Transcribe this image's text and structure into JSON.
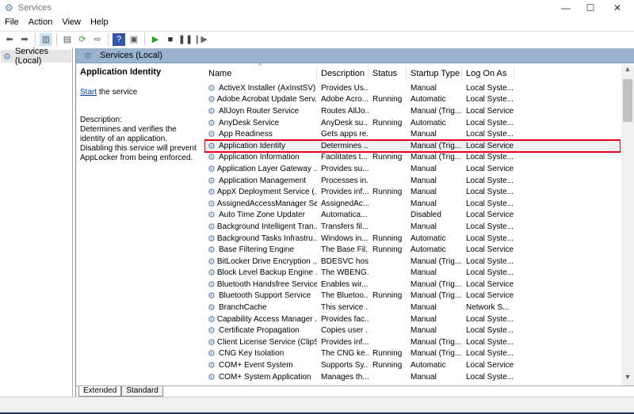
{
  "window": {
    "title": "Services",
    "minimize": "—",
    "maximize": "☐",
    "close": "✕"
  },
  "menu": [
    "File",
    "Action",
    "View",
    "Help"
  ],
  "tree": {
    "item": "Services (Local)"
  },
  "panel": {
    "title": "Services (Local)"
  },
  "detail": {
    "title": "Application Identity",
    "start_link": "Start",
    "start_rest": " the service",
    "desc_label": "Description:",
    "desc_text": "Determines and verifies the identity of an application. Disabling this service will prevent AppLocker from being enforced."
  },
  "columns": [
    "Name",
    "Description",
    "Status",
    "Startup Type",
    "Log On As"
  ],
  "rows": [
    [
      "ActiveX Installer (AxInstSV)",
      "Provides Us...",
      "",
      "Manual",
      "Local Syste..."
    ],
    [
      "Adobe Acrobat Update Serv...",
      "Adobe Acro...",
      "Running",
      "Automatic",
      "Local Syste..."
    ],
    [
      "AllJoyn Router Service",
      "Routes AllJo...",
      "",
      "Manual (Trig...",
      "Local Service"
    ],
    [
      "AnyDesk Service",
      "AnyDesk su...",
      "Running",
      "Automatic",
      "Local Syste..."
    ],
    [
      "App Readiness",
      "Gets apps re...",
      "",
      "Manual",
      "Local Syste..."
    ],
    [
      "Application Identity",
      "Determines ...",
      "",
      "Manual (Trig...",
      "Local Service"
    ],
    [
      "Application Information",
      "Facilitates t...",
      "Running",
      "Manual (Trig...",
      "Local Syste..."
    ],
    [
      "Application Layer Gateway ...",
      "Provides su...",
      "",
      "Manual",
      "Local Service"
    ],
    [
      "Application Management",
      "Processes in...",
      "",
      "Manual",
      "Local Syste..."
    ],
    [
      "AppX Deployment Service (...",
      "Provides inf...",
      "Running",
      "Manual",
      "Local Syste..."
    ],
    [
      "AssignedAccessManager Se...",
      "AssignedAc...",
      "",
      "Manual",
      "Local Syste..."
    ],
    [
      "Auto Time Zone Updater",
      "Automatica...",
      "",
      "Disabled",
      "Local Service"
    ],
    [
      "Background Intelligent Tran...",
      "Transfers fil...",
      "",
      "Manual",
      "Local Syste..."
    ],
    [
      "Background Tasks Infrastru...",
      "Windows in...",
      "Running",
      "Automatic",
      "Local Syste..."
    ],
    [
      "Base Filtering Engine",
      "The Base Fil...",
      "Running",
      "Automatic",
      "Local Service"
    ],
    [
      "BitLocker Drive Encryption ...",
      "BDESVC hos...",
      "",
      "Manual (Trig...",
      "Local Syste..."
    ],
    [
      "Block Level Backup Engine ...",
      "The WBENG...",
      "",
      "Manual",
      "Local Syste..."
    ],
    [
      "Bluetooth Handsfree Service",
      "Enables wir...",
      "",
      "Manual (Trig...",
      "Local Service"
    ],
    [
      "Bluetooth Support Service",
      "The Bluetoo...",
      "Running",
      "Manual (Trig...",
      "Local Service"
    ],
    [
      "BranchCache",
      "This service ...",
      "",
      "Manual",
      "Network S..."
    ],
    [
      "Capability Access Manager ...",
      "Provides fac...",
      "",
      "Manual",
      "Local Syste..."
    ],
    [
      "Certificate Propagation",
      "Copies user ...",
      "",
      "Manual",
      "Local Syste..."
    ],
    [
      "Client License Service (ClipS...",
      "Provides inf...",
      "",
      "Manual (Trig...",
      "Local Syste..."
    ],
    [
      "CNG Key Isolation",
      "The CNG ke...",
      "Running",
      "Manual (Trig...",
      "Local Syste..."
    ],
    [
      "COM+ Event System",
      "Supports Sy...",
      "Running",
      "Automatic",
      "Local Service"
    ],
    [
      "COM+ System Application",
      "Manages th...",
      "",
      "Manual",
      "Local Syste..."
    ]
  ],
  "selected_row": 5,
  "tabs": [
    "Extended",
    "Standard"
  ],
  "colors": {
    "header": "#9ab3cf",
    "highlight": "#e8001c"
  }
}
